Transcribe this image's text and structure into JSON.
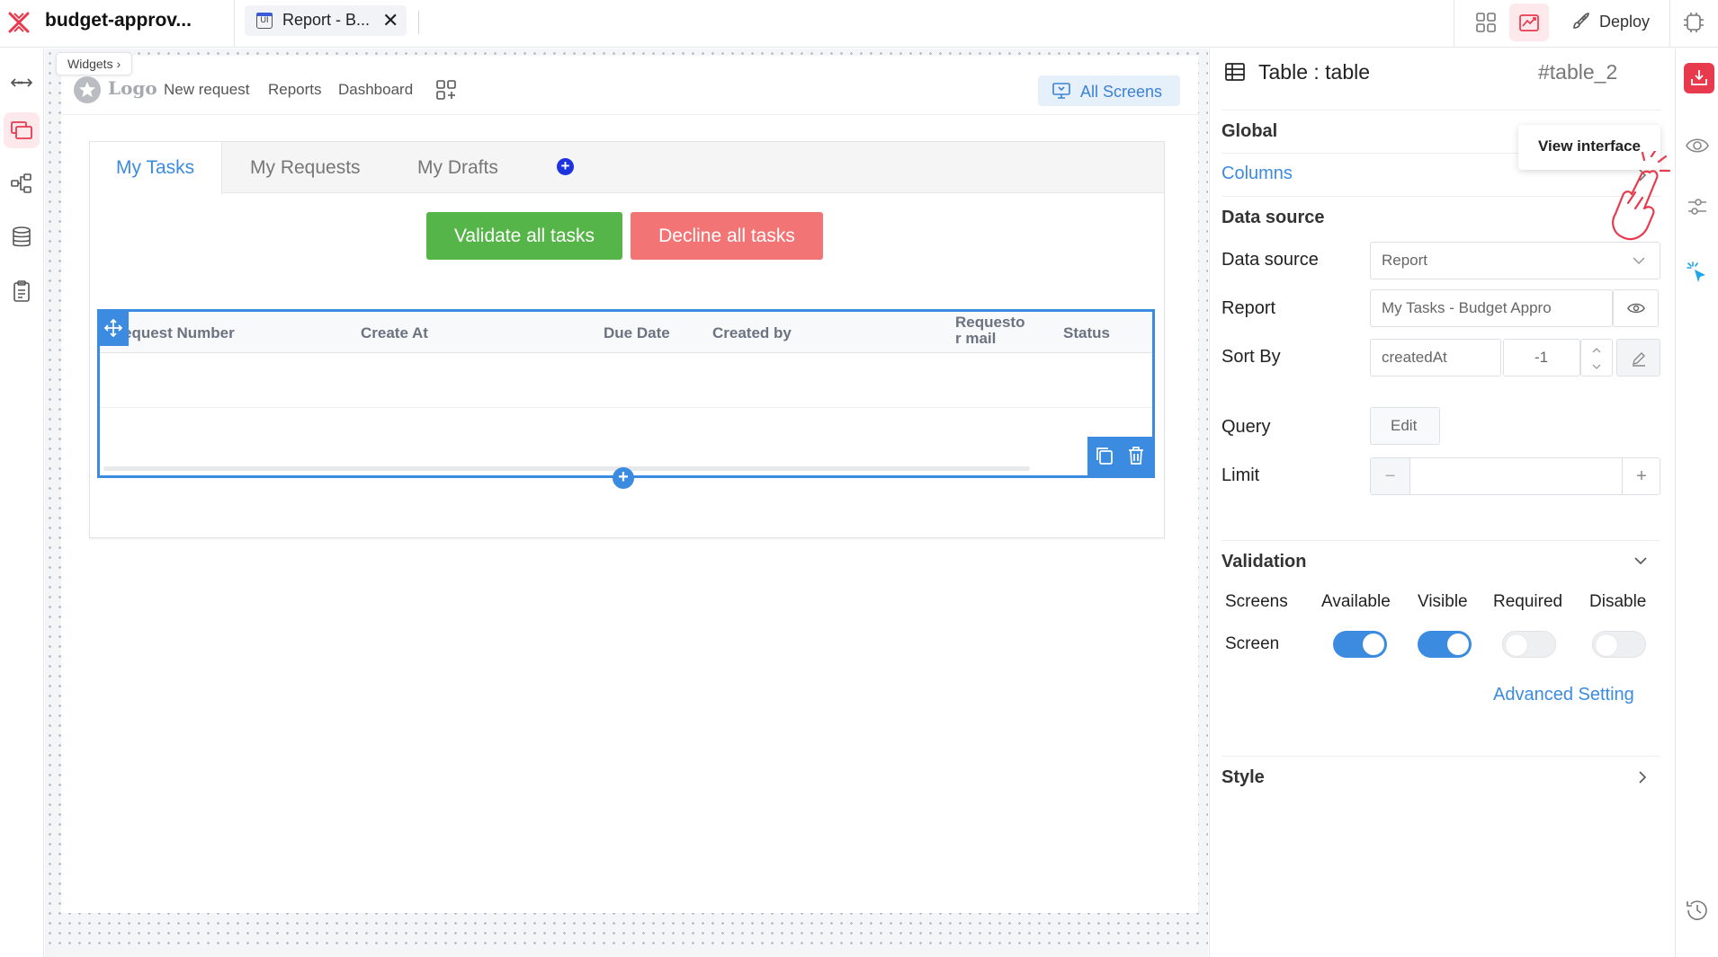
{
  "app": {
    "name": "budget-approv..."
  },
  "topbar": {
    "tab_label": "Report - B...",
    "tab_close": "✕",
    "tab_icon_text": "UI",
    "deploy_label": "Deploy"
  },
  "canvas": {
    "widgets_chip": "Widgets ›",
    "logo_text": "Logo",
    "nav": [
      "New request",
      "Reports",
      "Dashboard"
    ],
    "all_screens": "All Screens",
    "tabs": [
      "My Tasks",
      "My Requests",
      "My Drafts"
    ],
    "add_tab": "+",
    "validate_label": "Validate all tasks",
    "decline_label": "Decline all tasks",
    "table_columns": [
      "equest Number",
      "Create At",
      "Due Date",
      "Created by",
      "Requesto\nr mail",
      "Status"
    ],
    "add_row": "+"
  },
  "panel": {
    "title": "Table : table",
    "id": "#table_2",
    "global": "Global",
    "tooltip": "View interface",
    "columns": "Columns",
    "data_source_section": "Data source",
    "data_source_label": "Data source",
    "data_source_value": "Report",
    "report_label": "Report",
    "report_value": "My Tasks - Budget Appro",
    "sort_by_label": "Sort By",
    "sort_field": "createdAt",
    "sort_direction": "-1",
    "query_label": "Query",
    "query_button": "Edit",
    "limit_label": "Limit",
    "limit_value": "",
    "limit_minus": "−",
    "limit_plus": "+",
    "validation": "Validation",
    "validation_headers": [
      "Screens",
      "Available",
      "Visible",
      "Required",
      "Disable"
    ],
    "screen_row": {
      "label": "Screen",
      "available": true,
      "visible": true,
      "required": false,
      "disable": false
    },
    "advanced_setting": "Advanced Setting",
    "style": "Style"
  },
  "colors": {
    "accent_blue": "#3b8be0",
    "brand_red": "#e83a4d",
    "validate_green": "#56b548",
    "decline_red": "#f27474",
    "active_bg": "#fde8ec"
  },
  "icons": {
    "left_sidebar": [
      "arrows-horizontal-icon",
      "screens-icon",
      "workflow-icon",
      "database-icon",
      "clipboard-icon"
    ],
    "rail": [
      "download-icon",
      "eye-icon",
      "sliders-icon",
      "cursor-click-icon",
      "history-icon"
    ]
  }
}
